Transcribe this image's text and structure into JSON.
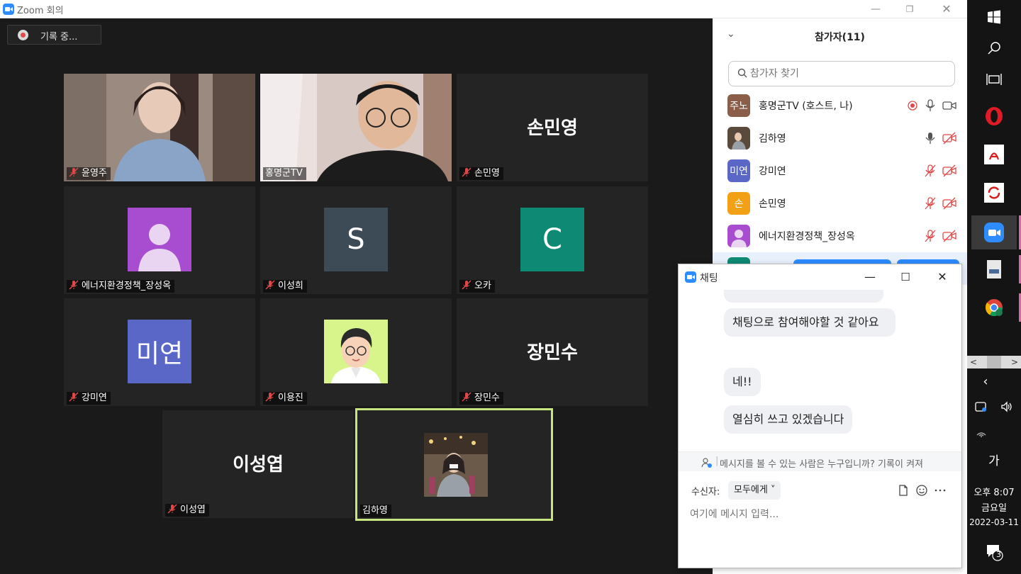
{
  "window": {
    "title": "Zoom 회의"
  },
  "recording": {
    "label": "기록 중..."
  },
  "tiles": [
    {
      "name": "윤영주",
      "kind": "video",
      "muted": true
    },
    {
      "name": "홍명군TV",
      "kind": "video",
      "muted": false
    },
    {
      "name": "손민영",
      "kind": "text",
      "big": "손민영",
      "muted": true
    },
    {
      "name": "에너지환경정책_장성옥",
      "kind": "avatar",
      "avatar": "person-icon",
      "color": "#a84cd0",
      "muted": true
    },
    {
      "name": "이성희",
      "kind": "avatar",
      "avatar": "S",
      "color": "#3d4b57",
      "muted": true
    },
    {
      "name": "오카",
      "kind": "avatar",
      "avatar": "C",
      "color": "#0e8a74",
      "muted": true
    },
    {
      "name": "강미연",
      "kind": "avatar",
      "avatar": "미연",
      "color": "#5a67c6",
      "muted": true
    },
    {
      "name": "이용진",
      "kind": "avatar",
      "avatar": "cartoon-face",
      "color": "#d8f58c",
      "muted": true
    },
    {
      "name": "장민수",
      "kind": "text",
      "big": "장민수",
      "muted": true
    },
    {
      "name": "이성엽",
      "kind": "text",
      "big": "이성엽",
      "muted": true
    },
    {
      "name": "김하영",
      "kind": "photo",
      "muted": false,
      "speaking": true
    }
  ],
  "participants": {
    "title": "참가자(11)",
    "search_placeholder": "참가자 찾기",
    "list": [
      {
        "initials": "주노",
        "color": "#8b5e4a",
        "name": "홍명군TV (호스트, 나)",
        "recording": true,
        "mic": "on",
        "cam": "on"
      },
      {
        "initials": "",
        "color": "#9b8a6f",
        "name": "김하영",
        "recording": false,
        "mic": "on",
        "cam": "off"
      },
      {
        "initials": "미연",
        "color": "#5a67c6",
        "name": "강미연",
        "recording": false,
        "mic": "off",
        "cam": "off"
      },
      {
        "initials": "손",
        "color": "#f2a016",
        "name": "손민영",
        "recording": false,
        "mic": "off",
        "cam": "off"
      },
      {
        "initials": "",
        "color": "#a84cd0",
        "name": "에너지환경정책_장성옥",
        "recording": false,
        "mic": "off",
        "cam": "off"
      }
    ]
  },
  "chat": {
    "title": "채팅",
    "messages": [
      "채팅으로 참여해야할 것 같아요",
      "네!!",
      "열심히 쓰고 있겠습니다"
    ],
    "notice": "메시지를 볼 수 있는 사람은 누구입니까? 기록이 켜져",
    "recipient_label": "수신자:",
    "recipient_value": "모두에게",
    "input_placeholder": "여기에 메시지 입력..."
  },
  "taskbar": {
    "ime": "가",
    "time": "오후 8:07",
    "day": "금요일",
    "date": "2022-03-11",
    "notifications": "3"
  },
  "colors": {
    "zoom_blue": "#2d8cff",
    "mute_red": "#e04848",
    "speaker_border": "#c8e680"
  }
}
